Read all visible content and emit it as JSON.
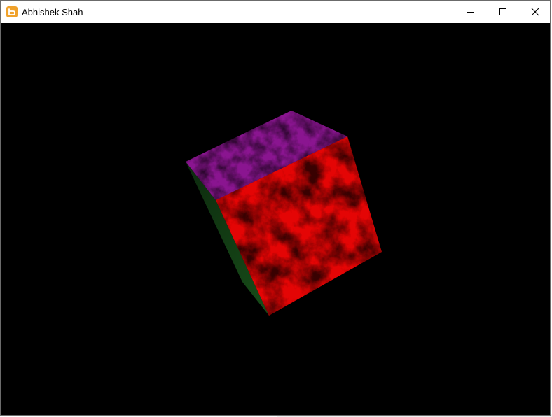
{
  "window": {
    "title": "Abhishek Shah",
    "icon": "app-icon",
    "controls": {
      "minimize": "minimize-icon",
      "maximize": "maximize-icon",
      "close": "close-icon"
    }
  },
  "scene": {
    "background_color": "#000000",
    "cube": {
      "top_face_color": "#7a127f",
      "front_face_color": "#e00000",
      "left_face_color": "#0f3a10",
      "texture": "marble"
    }
  },
  "colors": {
    "titlebar": "#ffffff",
    "icon_accent": "#f0a22b"
  }
}
